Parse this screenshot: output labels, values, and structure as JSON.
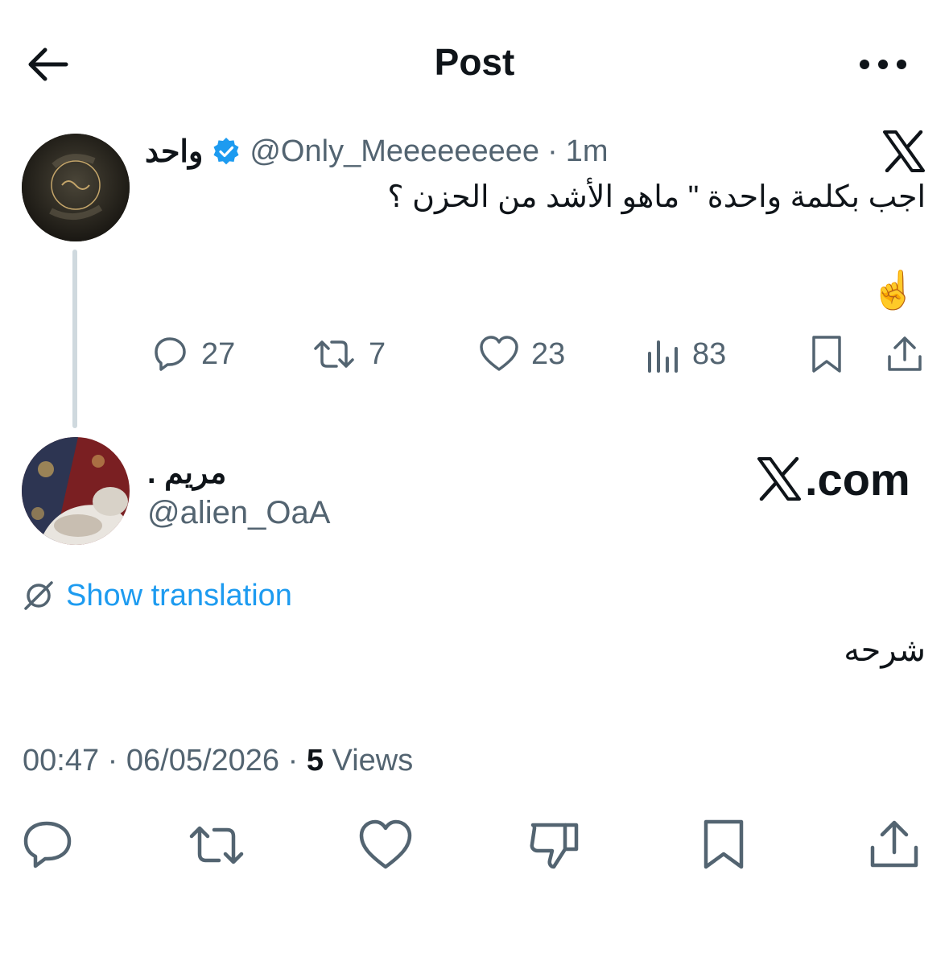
{
  "topbar": {
    "title": "Post",
    "back_icon": "arrow-left-icon",
    "more_icon": "more-horizontal-icon"
  },
  "quoted_post": {
    "author_name": "واحد",
    "verified_icon": "verified-badge-icon",
    "handle": "@Only_Meeeeeeeee",
    "separator": "·",
    "time": "1m",
    "text": "اجب بكلمة واحدة \" ماهو الأشد من الحزن ؟",
    "emoji": "☝️",
    "metrics": {
      "replies": "27",
      "reposts": "7",
      "likes": "23",
      "views": "83"
    }
  },
  "reply_post": {
    "author_name": "مريم .",
    "handle": "@alien_OaA",
    "brand": ".com",
    "show_translation": "Show translation",
    "text": "شرحه",
    "time": "00:47",
    "date": "06/05/2026",
    "separator": "·",
    "views_count": "5",
    "views_label": "Views"
  },
  "colors": {
    "text": "#0f1419",
    "secondary": "#536471",
    "accent": "#1d9bf0",
    "thread_line": "#cfd9de"
  }
}
